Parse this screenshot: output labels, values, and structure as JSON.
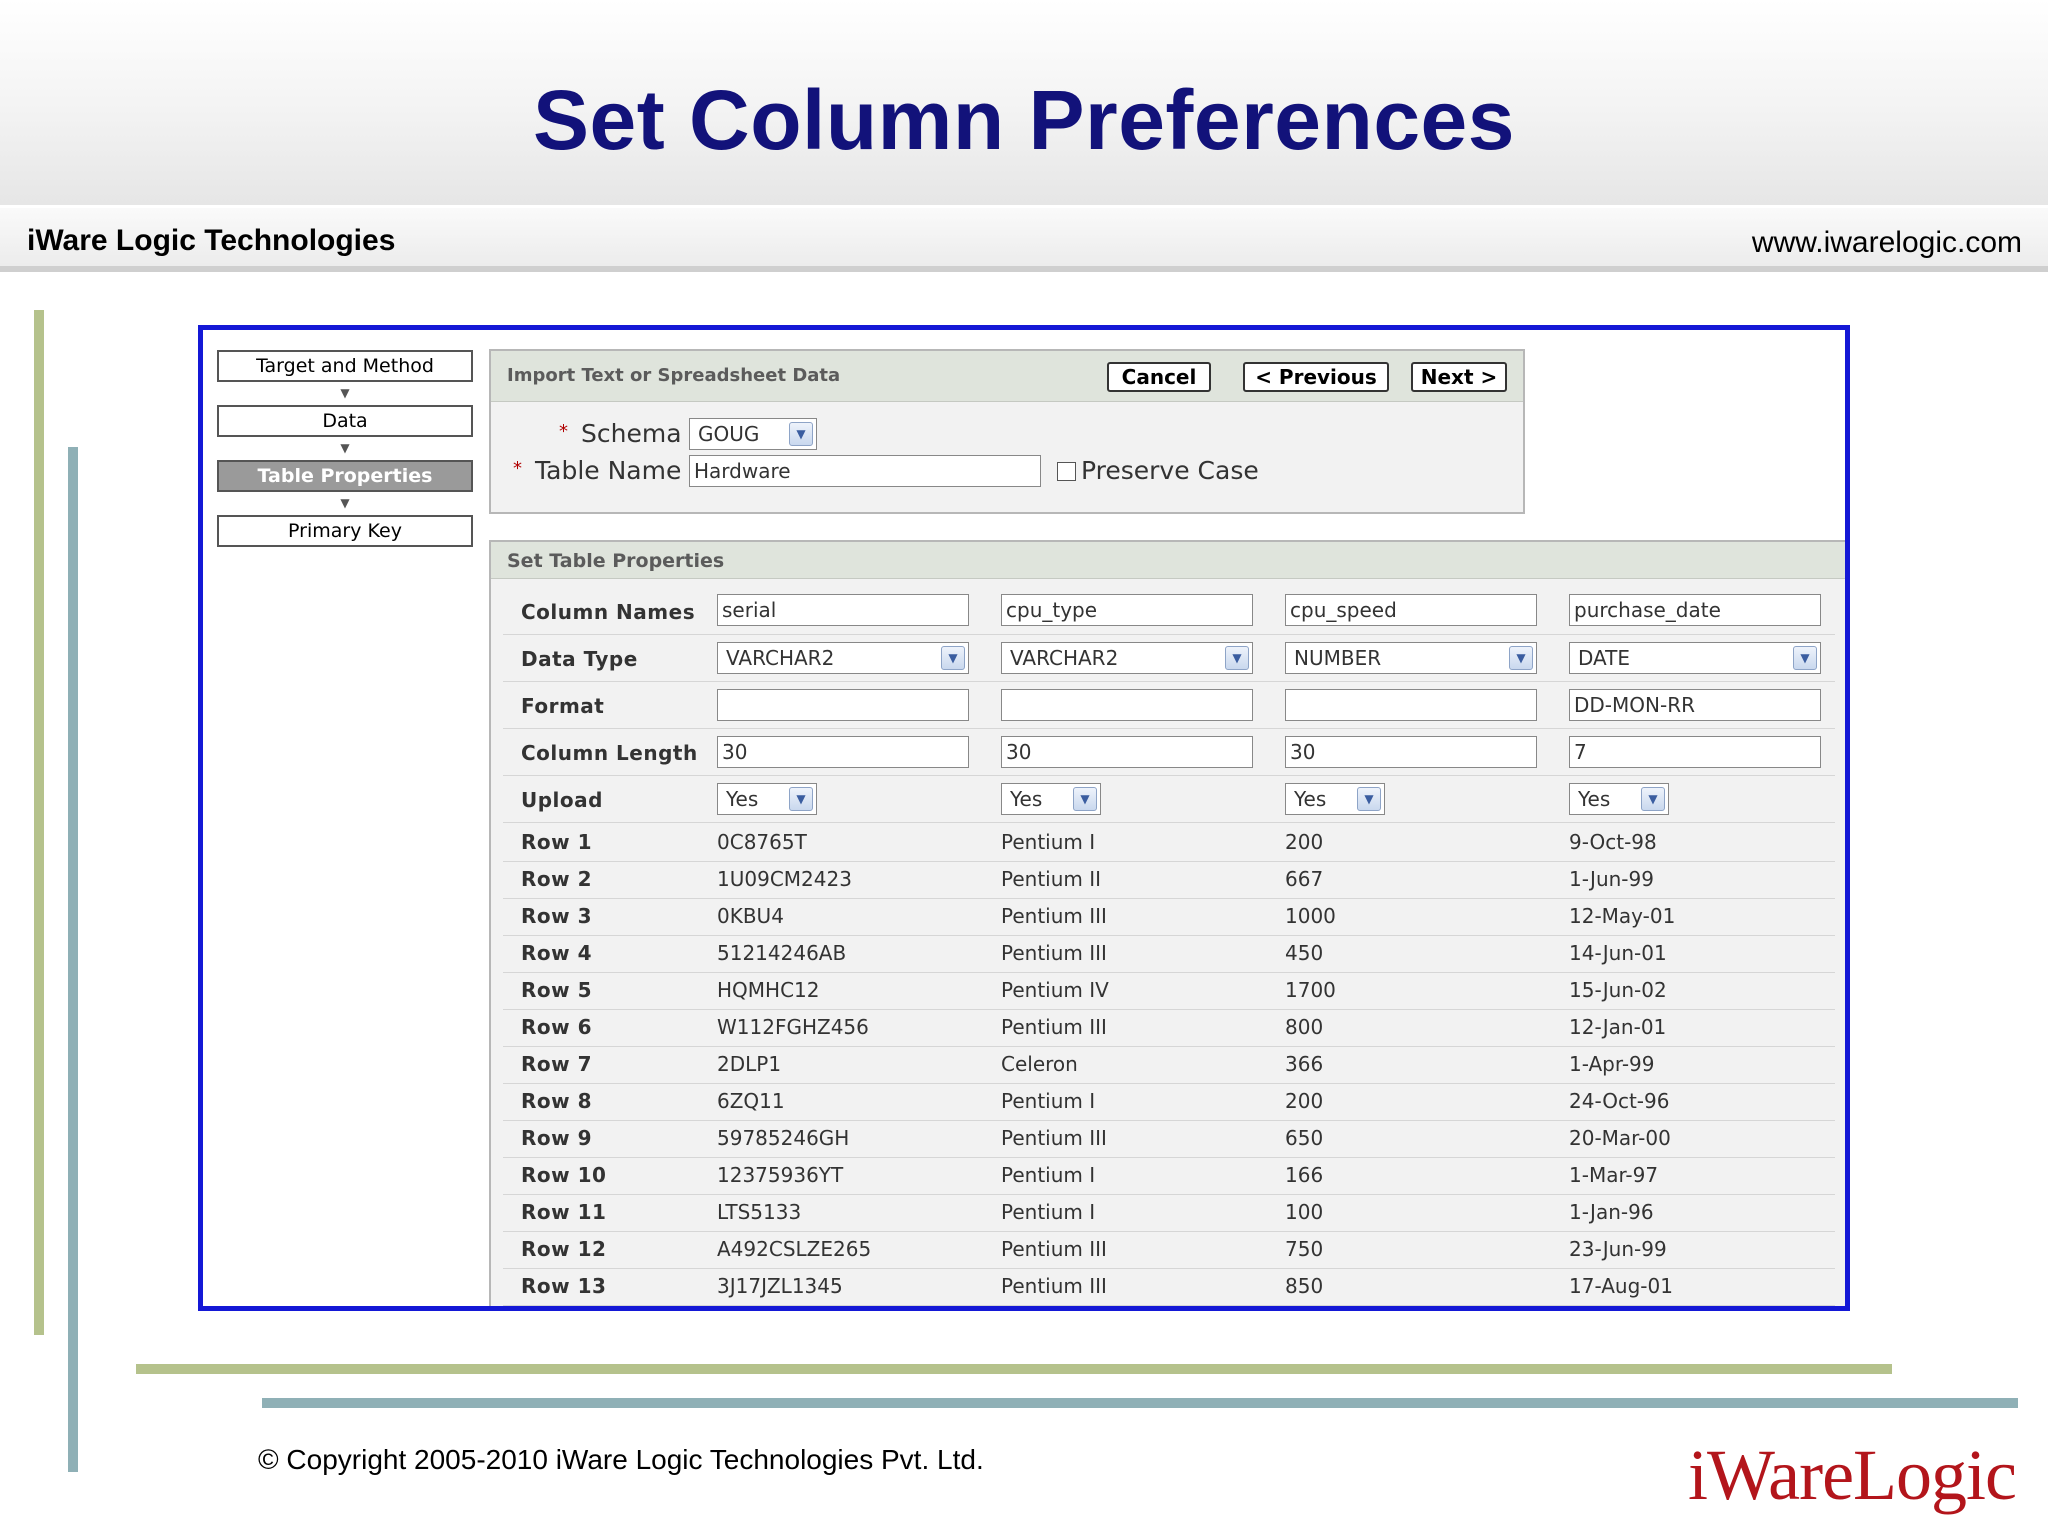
{
  "slide": {
    "title": "Set Column Preferences",
    "company": "iWare Logic Technologies",
    "url": "www.iwarelogic.com",
    "copyright": "© Copyright 2005-2010 iWare Logic Technologies Pvt. Ltd.",
    "logo": "iWareLogic"
  },
  "colors": {
    "title": "#12127a",
    "frame": "#1418d6",
    "logo": "#b3151b"
  },
  "steps": [
    {
      "label": "Target and Method",
      "active": false
    },
    {
      "label": "Data",
      "active": false
    },
    {
      "label": "Table Properties",
      "active": true
    },
    {
      "label": "Primary Key",
      "active": false
    }
  ],
  "import_box": {
    "title": "Import Text or Spreadsheet Data",
    "cancel": "Cancel",
    "previous": "< Previous",
    "next": "Next >",
    "schema_label": "Schema",
    "schema_value": "GOUG",
    "table_name_label": "Table Name",
    "table_name_value": "Hardware",
    "preserve_case_label": "Preserve Case",
    "required_marker": "*"
  },
  "table_props": {
    "title": "Set Table Properties",
    "labels": {
      "column_names": "Column Names",
      "data_type": "Data Type",
      "format": "Format",
      "column_length": "Column Length",
      "upload": "Upload"
    },
    "columns": [
      {
        "name": "serial",
        "type": "VARCHAR2",
        "format": "",
        "length": "30",
        "upload": "Yes"
      },
      {
        "name": "cpu_type",
        "type": "VARCHAR2",
        "format": "",
        "length": "30",
        "upload": "Yes"
      },
      {
        "name": "cpu_speed",
        "type": "NUMBER",
        "format": "",
        "length": "30",
        "upload": "Yes"
      },
      {
        "name": "purchase_date",
        "type": "DATE",
        "format": "DD-MON-RR",
        "length": "7",
        "upload": "Yes"
      }
    ],
    "rows": [
      {
        "label": "Row 1",
        "values": [
          "0C8765T",
          "Pentium I",
          "200",
          "9-Oct-98"
        ]
      },
      {
        "label": "Row 2",
        "values": [
          "1U09CM2423",
          "Pentium II",
          "667",
          "1-Jun-99"
        ]
      },
      {
        "label": "Row 3",
        "values": [
          "0KBU4",
          "Pentium III",
          "1000",
          "12-May-01"
        ]
      },
      {
        "label": "Row 4",
        "values": [
          "51214246AB",
          "Pentium III",
          "450",
          "14-Jun-01"
        ]
      },
      {
        "label": "Row 5",
        "values": [
          "HQMHC12",
          "Pentium IV",
          "1700",
          "15-Jun-02"
        ]
      },
      {
        "label": "Row 6",
        "values": [
          "W112FGHZ456",
          "Pentium III",
          "800",
          "12-Jan-01"
        ]
      },
      {
        "label": "Row 7",
        "values": [
          "2DLP1",
          "Celeron",
          "366",
          "1-Apr-99"
        ]
      },
      {
        "label": "Row 8",
        "values": [
          "6ZQ11",
          "Pentium I",
          "200",
          "24-Oct-96"
        ]
      },
      {
        "label": "Row 9",
        "values": [
          "59785246GH",
          "Pentium III",
          "650",
          "20-Mar-00"
        ]
      },
      {
        "label": "Row 10",
        "values": [
          "12375936YT",
          "Pentium I",
          "166",
          "1-Mar-97"
        ]
      },
      {
        "label": "Row 11",
        "values": [
          "LTS5133",
          "Pentium I",
          "100",
          "1-Jan-96"
        ]
      },
      {
        "label": "Row 12",
        "values": [
          "A492CSLZE265",
          "Pentium III",
          "750",
          "23-Jun-99"
        ]
      },
      {
        "label": "Row 13",
        "values": [
          "3J17JZL1345",
          "Pentium III",
          "850",
          "17-Aug-01"
        ]
      }
    ]
  }
}
